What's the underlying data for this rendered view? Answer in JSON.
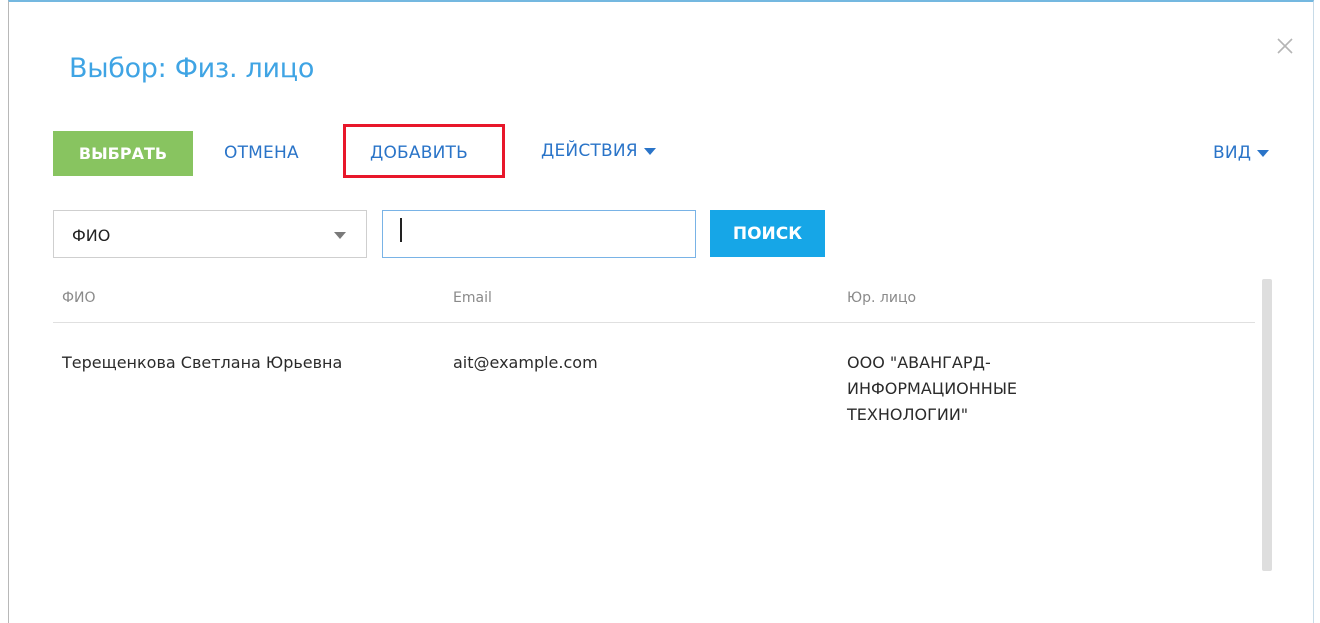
{
  "dialog": {
    "title": "Выбор: Физ. лицо",
    "close_icon": "close-icon"
  },
  "toolbar": {
    "select_label": "ВЫБРАТЬ",
    "cancel_label": "ОТМЕНА",
    "add_label": "ДОБАВИТЬ",
    "actions_label": "ДЕЙСТВИЯ",
    "view_label": "ВИД",
    "accent_color": "#88c460",
    "highlight_color": "#e8172a"
  },
  "filter": {
    "field_value": "ФИО",
    "search_value": "",
    "search_button": "ПОИСК",
    "search_button_color": "#16a6e7"
  },
  "table": {
    "columns": [
      "ФИО",
      "Email",
      "Юр. лицо"
    ],
    "rows": [
      {
        "fio": "Терещенкова Светлана Юрьевна",
        "email": "ait@example.com",
        "company_lines": [
          "ООО \"АВАНГАРД-",
          "ИНФОРМАЦИОННЫЕ",
          "ТЕХНОЛОГИИ\""
        ]
      }
    ]
  }
}
